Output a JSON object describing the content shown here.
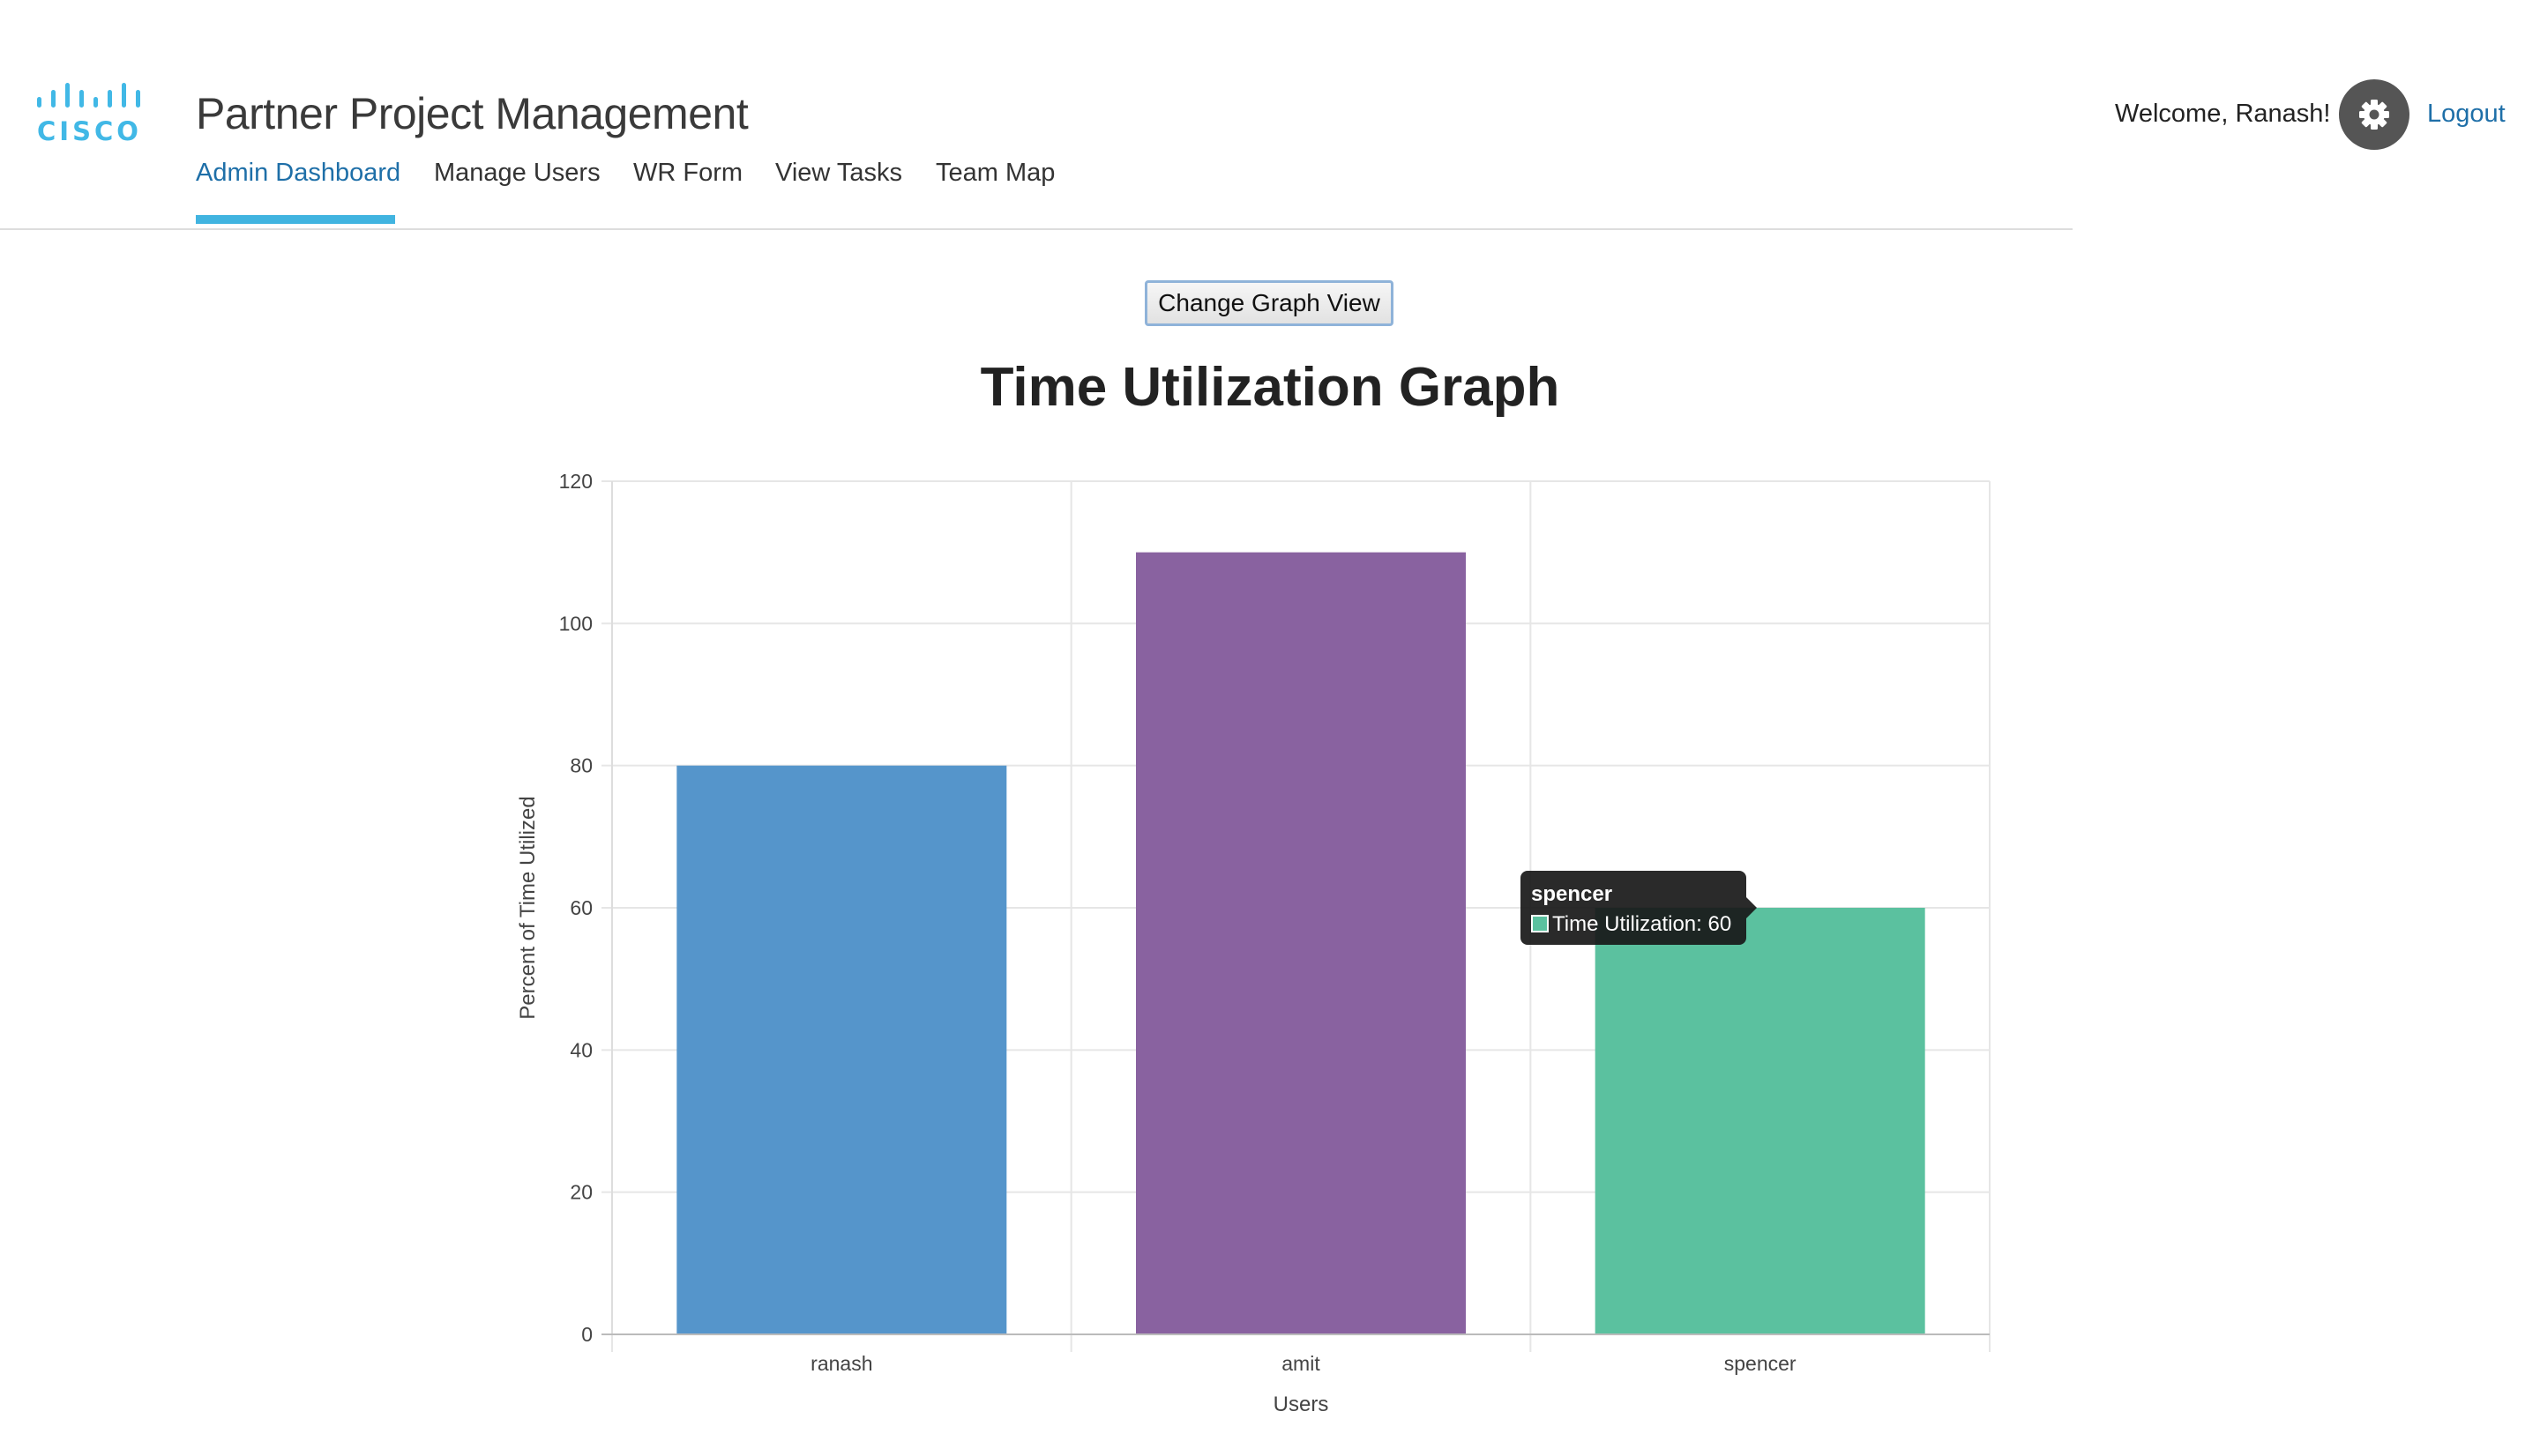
{
  "brand": {
    "logo_text": "CISCO",
    "color": "#41b8e6"
  },
  "header": {
    "app_title": "Partner Project Management",
    "welcome": "Welcome, Ranash!",
    "settings_icon": "gear-icon",
    "logout": "Logout"
  },
  "nav": {
    "items": [
      {
        "label": "Admin Dashboard",
        "active": true
      },
      {
        "label": "Manage Users"
      },
      {
        "label": "WR Form"
      },
      {
        "label": "View Tasks"
      },
      {
        "label": "Team Map"
      }
    ],
    "active_color": "#1e6fa8",
    "underline_color": "#41b4e0"
  },
  "main": {
    "change_graph_button": "Change Graph View"
  },
  "chart_data": {
    "type": "bar",
    "title": "Time Utilization Graph",
    "xlabel": "Users",
    "ylabel": "Percent of Time Utilized",
    "categories": [
      "ranash",
      "amit",
      "spencer"
    ],
    "series": [
      {
        "name": "Time Utilization",
        "values": [
          80,
          110,
          60
        ]
      }
    ],
    "bar_colors": [
      "#5595cb",
      "#8962a0",
      "#5bc19f"
    ],
    "ylim": [
      0,
      120
    ],
    "yticks": [
      0,
      20,
      40,
      60,
      80,
      100,
      120
    ],
    "grid": true,
    "legend": "none"
  },
  "tooltip": {
    "title": "spencer",
    "text": "Time Utilization: 60",
    "swatch_color": "#5bc19f"
  }
}
